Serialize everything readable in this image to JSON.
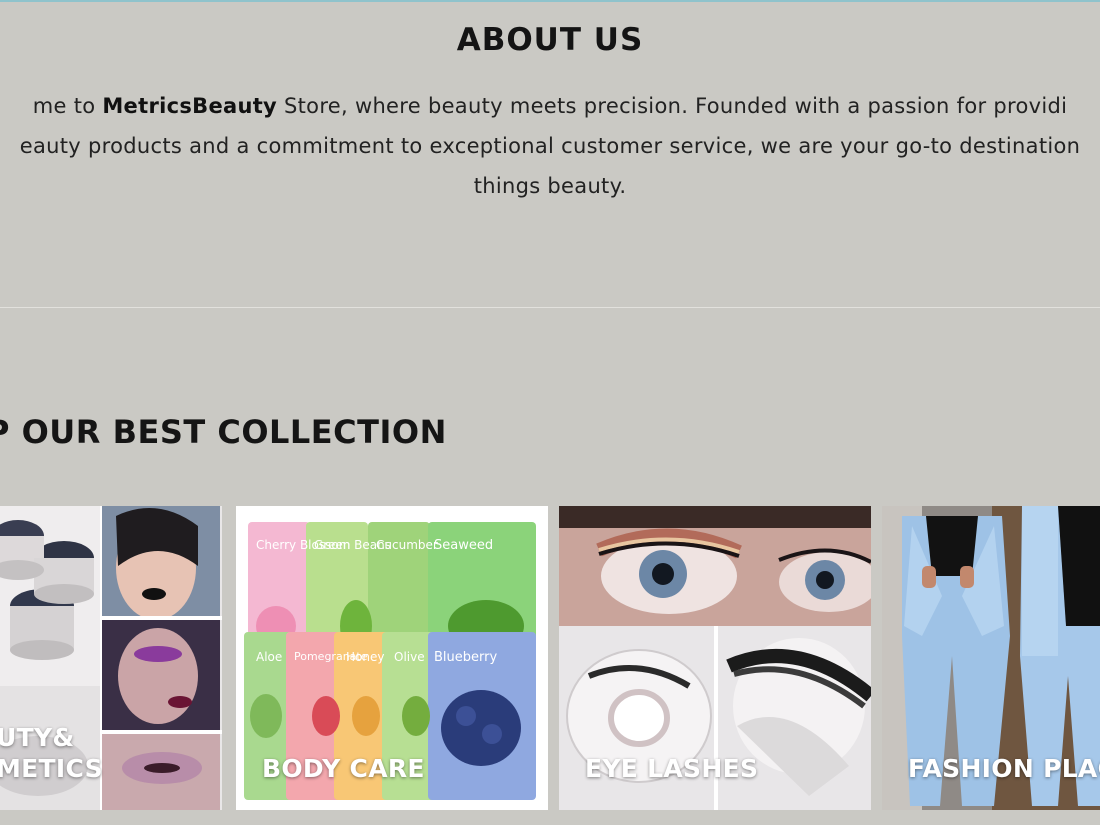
{
  "about": {
    "title": "ABOUT US",
    "line1_pre": "me to ",
    "line1_brand": "MetricsBeauty",
    "line1_post": " Store, where beauty meets precision. Founded with a passion for providi",
    "line2": "eauty products and a commitment to exceptional customer service, we are your go-to destination",
    "line3": "things beauty."
  },
  "collection": {
    "heading": "P OUR BEST COLLECTION",
    "cards": [
      {
        "label_line1": "UTY&",
        "label_line2": "METICS"
      },
      {
        "label": "BODY CARE"
      },
      {
        "label": "EYE LASHES"
      },
      {
        "label": "FASHION PLAC"
      }
    ]
  },
  "mask_labels": [
    "Cherry Blossom",
    "Green Beans",
    "Cucumber",
    "Seaweed",
    "Aloe",
    "Pomegranate",
    "Honey",
    "Olive",
    "Blueberry"
  ],
  "colors": {
    "background": "#cac9c4",
    "heading": "#141414",
    "label": "#ffffff",
    "divider": "#e2e1dd"
  }
}
